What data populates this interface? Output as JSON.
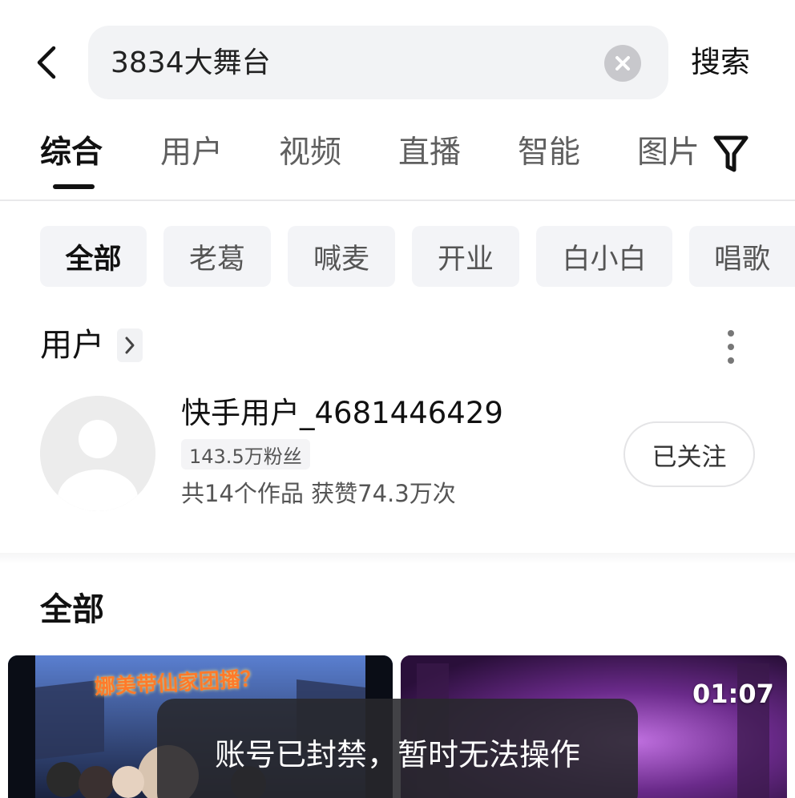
{
  "search": {
    "query": "3834大舞台",
    "submit_label": "搜索"
  },
  "tabs": [
    {
      "label": "综合",
      "active": true
    },
    {
      "label": "用户",
      "active": false
    },
    {
      "label": "视频",
      "active": false
    },
    {
      "label": "直播",
      "active": false
    },
    {
      "label": "智能",
      "active": false
    },
    {
      "label": "图片",
      "active": false
    }
  ],
  "chips": [
    {
      "label": "全部",
      "active": true
    },
    {
      "label": "老葛",
      "active": false
    },
    {
      "label": "喊麦",
      "active": false
    },
    {
      "label": "开业",
      "active": false
    },
    {
      "label": "白小白",
      "active": false
    },
    {
      "label": "唱歌",
      "active": false
    }
  ],
  "user_section": {
    "title": "用户",
    "user": {
      "name": "快手用户_4681446429",
      "fans": "143.5万粉丝",
      "stats": "共14个作品 获赞74.3万次",
      "follow_label": "已关注"
    }
  },
  "all_section": {
    "title": "全部",
    "videos": [
      {
        "caption": "娜美带仙家团播？"
      },
      {
        "duration": "01:07"
      }
    ]
  },
  "toast": {
    "message": "账号已封禁，暂时无法操作"
  },
  "icons": {
    "back": "chevron-left-icon",
    "clear": "close-circle-icon",
    "filter": "filter-icon",
    "more": "more-vertical-icon",
    "chevron": "chevron-right-icon"
  }
}
